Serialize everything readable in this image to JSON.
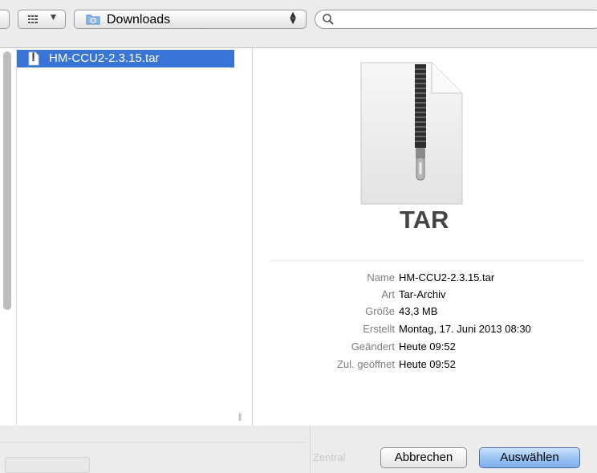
{
  "toolbar": {
    "view_icon": "grid-icon",
    "location": {
      "label": "Downloads",
      "icon": "folder-icon"
    },
    "search": {
      "value": "",
      "placeholder": "",
      "icon": "search-icon"
    }
  },
  "file_list": {
    "items": [
      {
        "name": "HM-CCU2-2.3.15.tar",
        "icon": "archive-file-icon",
        "selected": true
      }
    ]
  },
  "preview": {
    "icon_label": "TAR",
    "info": [
      {
        "key": "Name",
        "value": "HM-CCU2-2.3.15.tar"
      },
      {
        "key": "Art",
        "value": "Tar-Archiv"
      },
      {
        "key": "Größe",
        "value": "43,3 MB"
      },
      {
        "key": "Erstellt",
        "value": "Montag, 17. Juni 2013 08:30"
      },
      {
        "key": "Geändert",
        "value": "Heute 09:52"
      },
      {
        "key": "Zul. geöffnet",
        "value": "Heute 09:52"
      }
    ]
  },
  "background": {
    "ghost_text": "Zentral"
  },
  "buttons": {
    "cancel": "Abbrechen",
    "choose": "Auswählen"
  },
  "colors": {
    "selection": "#3875d7",
    "default_button": "#9bc4f4"
  }
}
